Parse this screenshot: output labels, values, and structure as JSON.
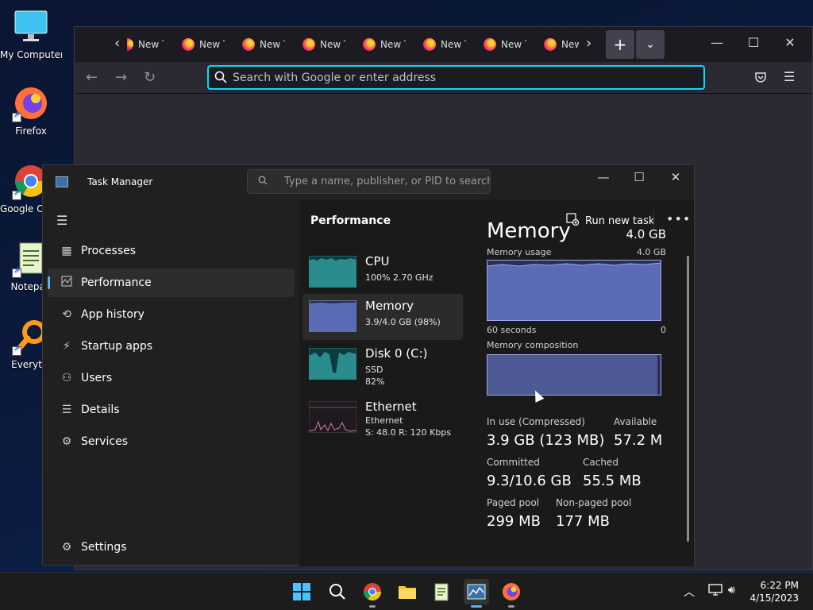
{
  "desktop": {
    "icons": [
      {
        "label": "My Computer"
      },
      {
        "label": "Firefox"
      },
      {
        "label": "Google Chrom"
      },
      {
        "label": "Notepad"
      },
      {
        "label": "Everythi"
      }
    ]
  },
  "firefox": {
    "tabs": [
      "New T",
      "New T",
      "New T",
      "New T",
      "New T",
      "New T",
      "New T",
      "New"
    ],
    "new_tab": "+",
    "url_placeholder": "Search with Google or enter address"
  },
  "task_manager": {
    "title": "Task Manager",
    "search_placeholder": "Type a name, publisher, or PID to search",
    "nav": [
      {
        "label": "Processes",
        "icon": "grid-icon"
      },
      {
        "label": "Performance",
        "icon": "pulse-icon",
        "active": true
      },
      {
        "label": "App history",
        "icon": "history-icon"
      },
      {
        "label": "Startup apps",
        "icon": "startup-icon"
      },
      {
        "label": "Users",
        "icon": "users-icon"
      },
      {
        "label": "Details",
        "icon": "list-icon"
      },
      {
        "label": "Services",
        "icon": "gear-icon"
      }
    ],
    "settings_label": "Settings",
    "header": "Performance",
    "run_new_task": "Run new task",
    "resources": [
      {
        "name": "CPU",
        "sub1": "100% 2.70 GHz",
        "sub2": ""
      },
      {
        "name": "Memory",
        "sub1": "3.9/4.0 GB (98%)",
        "sub2": ""
      },
      {
        "name": "Disk 0 (C:)",
        "sub1": "SSD",
        "sub2": "82%"
      },
      {
        "name": "Ethernet",
        "sub1": "Ethernet",
        "sub2": "S: 48.0  R: 120 Kbps"
      }
    ],
    "detail": {
      "title": "Memory",
      "capacity": "4.0 GB",
      "usage_label": "Memory usage",
      "usage_max": "4.0 GB",
      "axis_left": "60 seconds",
      "axis_right": "0",
      "composition_label": "Memory composition",
      "stats": [
        {
          "label": "In use (Compressed)",
          "value": "3.9 GB (123 MB)"
        },
        {
          "label": "Available",
          "value": "57.2 M"
        },
        {
          "label": "Committed",
          "value": "9.3/10.6 GB"
        },
        {
          "label": "Cached",
          "value": "55.5 MB"
        },
        {
          "label": "Paged pool",
          "value": "299 MB"
        },
        {
          "label": "Non-paged pool",
          "value": "177 MB"
        }
      ],
      "composition_in_use_fraction": 0.98
    }
  },
  "taskbar": {
    "time": "6:22 PM",
    "date": "4/15/2023"
  },
  "colors": {
    "accent": "#5fb2f2",
    "memory_fill": "#5b6bb5",
    "memory_line": "#9aa8ea",
    "cpu_fill": "#2a8c8c",
    "eth_line": "#d977a8",
    "focus_ring": "#00ddff"
  }
}
